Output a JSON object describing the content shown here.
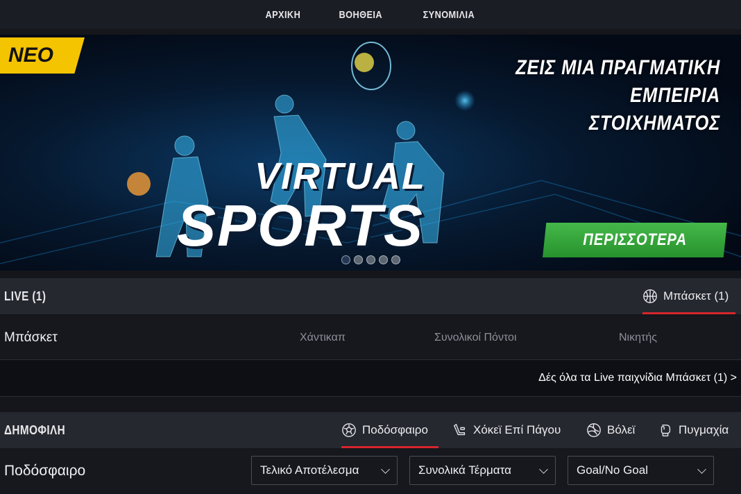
{
  "nav": {
    "items": [
      "ΑΡΧΙΚΗ",
      "ΒΟΗΘΕΙΑ",
      "ΣΥΝΟΜΙΛΙΑ"
    ]
  },
  "banner": {
    "badge": "ΝΕΟ",
    "headline": [
      "ΖΕΙΣ ΜΙΑ ΠΡΑΓΜΑΤΙΚΗ",
      "ΕΜΠΕΙΡΙΑ",
      "ΣΤΟΙΧΗΜΑΤΟΣ"
    ],
    "title_line1": "VIRTUAL",
    "title_line2": "SPORTS",
    "cta": "ΠΕΡΙΣΣΟΤΕΡΑ",
    "slides": 5,
    "active_slide": 1,
    "cta_color": "#3aa83f",
    "badge_color": "#f5c400"
  },
  "live": {
    "title": "LIVE (1)",
    "tab_label": "Μπάσκετ (1)",
    "tab_icon": "basketball-icon",
    "sport": "Μπάσκετ",
    "columns": [
      "Χάντικαπ",
      "Συνολικοί Πόντοι",
      "Νικητής"
    ],
    "see_all": "Δές όλα τα Live παιχνίδια Μπάσκετ (1) >"
  },
  "popular": {
    "title": "ΔΗΜΟΦΙΛΗ",
    "tabs": [
      {
        "label": "Ποδόσφαιρο",
        "icon": "soccer-ball-icon",
        "active": true
      },
      {
        "label": "Χόκεϊ Επί Πάγου",
        "icon": "ice-hockey-icon",
        "active": false
      },
      {
        "label": "Βόλεϊ",
        "icon": "volleyball-icon",
        "active": false
      },
      {
        "label": "Πυγμαχία",
        "icon": "boxing-glove-icon",
        "active": false
      }
    ],
    "sport": "Ποδόσφαιρο",
    "selects": [
      "Τελικό Αποτέλεσμα",
      "Συνολικά Τέρματα",
      "Goal/No Goal"
    ]
  },
  "colors": {
    "accent_red": "#d6262c",
    "header_bg": "#262830"
  }
}
